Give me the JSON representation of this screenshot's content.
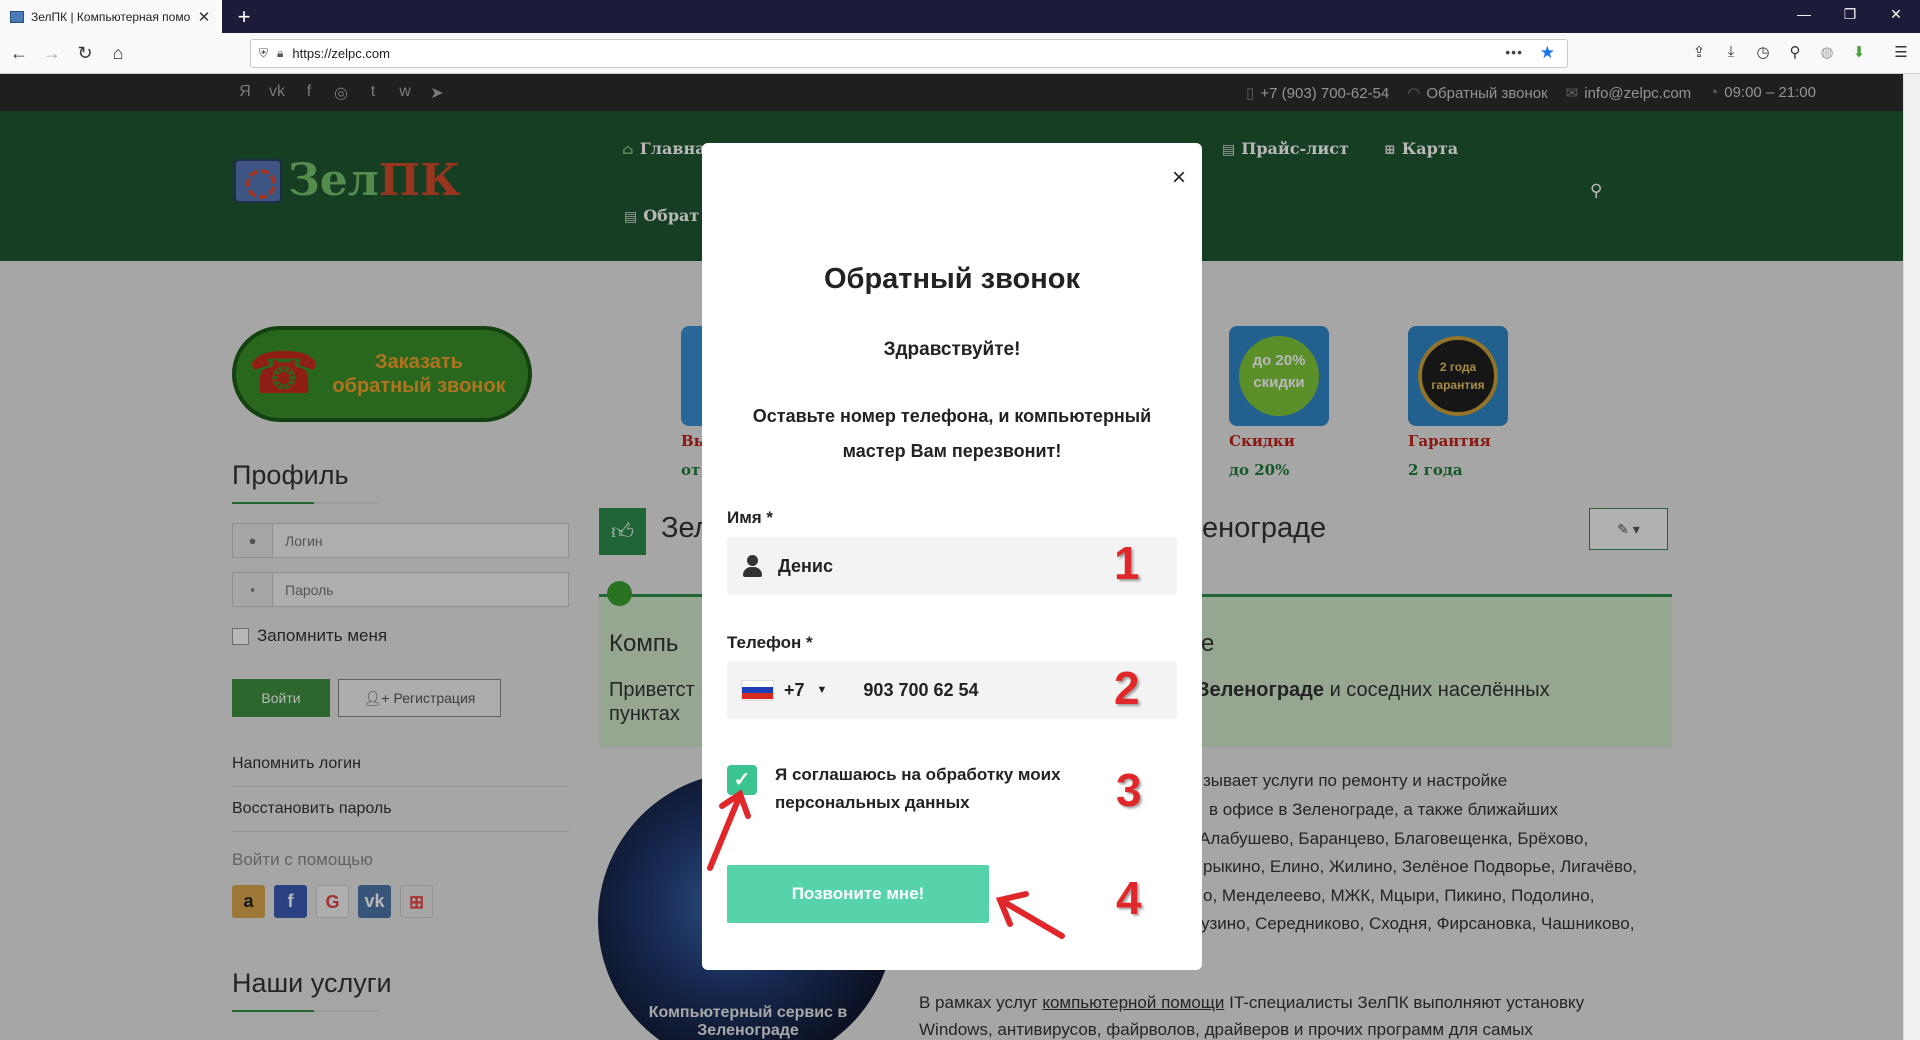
{
  "browser": {
    "tab_title": "ЗелПК | Компьютерная помо",
    "url": "https://zelpc.com",
    "new_tab": "+",
    "tab_close": "✕"
  },
  "topbar": {
    "social": [
      "Я",
      "vk",
      "f",
      "◎",
      "t",
      "w",
      "➤"
    ],
    "phone": "+7 (903) 700-62-54",
    "callback": "Обратный звонок",
    "email": "info@zelpc.com",
    "hours": "09:00 – 21:00"
  },
  "header": {
    "logo_part1": "Зел",
    "logo_part2": "ПК",
    "menu": {
      "home": "Главна",
      "price": "Прайс-лист",
      "map": "Карта",
      "contacts": "Обрат"
    }
  },
  "sidebar": {
    "callbutton": {
      "line1": "Заказать",
      "line2": "обратный звонок"
    },
    "profile_title": "Профиль",
    "login_placeholder": "Логин",
    "password_placeholder": "Пароль",
    "remember": "Запомнить меня",
    "login_button": "Войти",
    "register_button": "Регистрация",
    "remind_login": "Напомнить логин",
    "restore_password": "Восстановить пароль",
    "login_with": "Войти с помощью",
    "services_title": "Наши услуги"
  },
  "features": [
    {
      "title": "Вы",
      "subtitle": "от"
    },
    {
      "title": "Скидки",
      "subtitle": "до 20%",
      "badge": "до 20% скидки"
    },
    {
      "title": "Гарантия",
      "subtitle": "2 года",
      "badge": "2 года гарантия"
    }
  ],
  "main": {
    "heading_left": "Зел",
    "heading_right": "енограде",
    "box_title_left": "Компь",
    "box_title_right": "е",
    "box_line1_left": "Приветст",
    "box_line1_bold": "Зеленограде",
    "box_line1_right": "и соседних населённых",
    "box_line2": "пунктах",
    "body_lines": [
      "зывает услуги по ремонту и настройке",
      "в офисе в Зеленограде, а также ближайших",
      "Алабушево, Баранцево, Благовещенка, Брёхово,",
      "рыкино, Елино, Жилино, Зелёное Подворье, Лигачёво,",
      "о, Менделеево, МЖК, Мцыри, Пикино, Подолино,",
      "узино, Середниково, Сходня, Фирсановка, Чашниково,"
    ],
    "para2_pre": "В рамках услуг ",
    "para2_link": "компьютерной помощи",
    "para2_post": " IT-специалисты ЗелПК выполняют установку",
    "para2_line2": "Windows, антивирусов, файрволов, драйверов и прочих программ для самых",
    "circle_caption": "Компьютерный сервис в Зеленограде"
  },
  "modal": {
    "title": "Обратный звонок",
    "greeting": "Здравствуйте!",
    "subtitle": "Оставьте номер телефона, и компьютерный мастер Вам перезвонит!",
    "name_label": "Имя *",
    "name_value": "Денис",
    "phone_label": "Телефон *",
    "country_code": "+7",
    "phone_value": "903 700 62 54",
    "consent": "Я соглашаюсь на обработку моих персональных данных",
    "submit": "Позвоните мне!",
    "close": "×",
    "annotations": [
      "1",
      "2",
      "3",
      "4"
    ]
  },
  "colors": {
    "header_green": "#1e5631",
    "accent_teal": "#57d3ac",
    "annotation_red": "#e0282a"
  }
}
